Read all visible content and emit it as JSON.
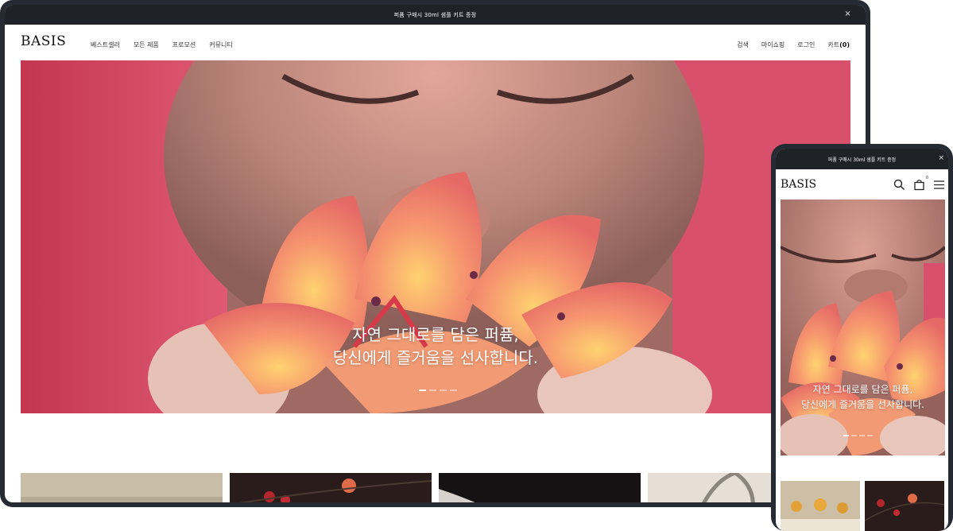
{
  "desktop": {
    "announcement": "퍼퓸 구매시 30ml 샘플 키트 증정",
    "close_icon": "×",
    "logo": "BASIS",
    "nav_left": [
      "베스트셀러",
      "모든 제품",
      "프로모션",
      "커뮤니티"
    ],
    "nav_right": [
      "검색",
      "마이쇼핑",
      "로그인"
    ],
    "cart_label": "카트",
    "cart_count": "(0)",
    "hero_line1": "자연 그대로를 담은 퍼퓸,",
    "hero_line2": "당신에게 즐거움을 선사합니다."
  },
  "mobile": {
    "announcement": "퍼퓸 구매시 30ml 샘플 키트 증정",
    "close_icon": "×",
    "logo": "BASIS",
    "cart_badge": "0",
    "icons": [
      "search-icon",
      "shopping-bag-icon",
      "hamburger-menu-icon"
    ],
    "hero_line1": "자연 그대로를 담은 퍼퓸,",
    "hero_line2": "당신에게 즐거움을 선사합니다."
  },
  "colors": {
    "frame": "#262a33",
    "banner": "#1f2227",
    "hero_pink": "#d94f6a",
    "flower_coral": "#f08a6a"
  }
}
